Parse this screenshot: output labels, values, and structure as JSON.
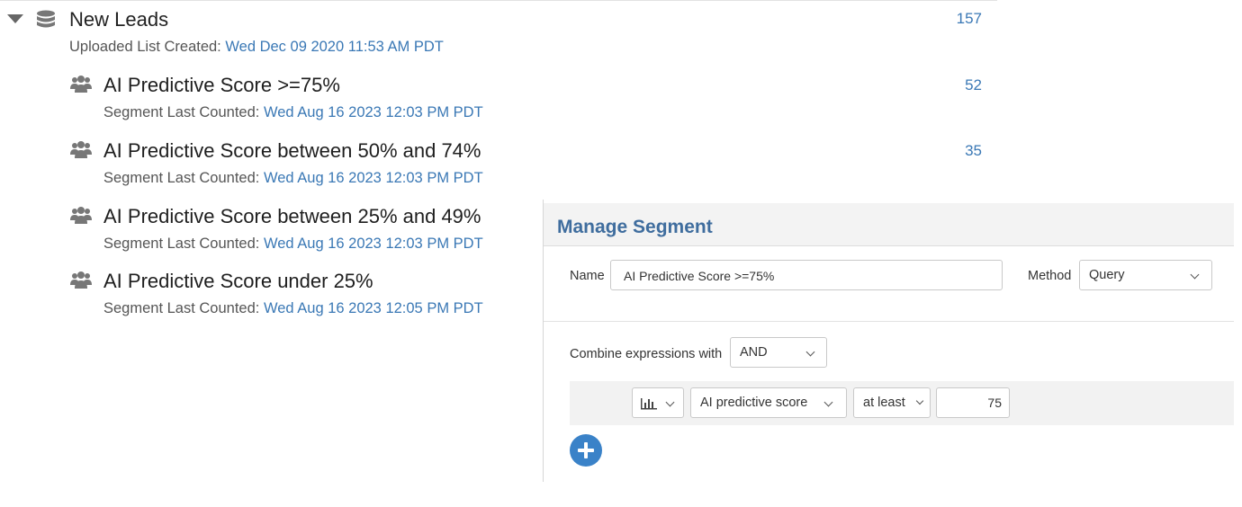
{
  "list": {
    "title": "New Leads",
    "created_label": "Uploaded List Created:",
    "created_value": "Wed Dec 09 2020 11:53 AM PDT",
    "count": "157",
    "icons": {
      "toggle": "caret-down-icon",
      "list": "database-icon"
    }
  },
  "segments": [
    {
      "title": "AI Predictive Score >=75%",
      "counted_label": "Segment Last Counted:",
      "counted_value": "Wed Aug 16 2023 12:03 PM PDT",
      "count": "52"
    },
    {
      "title": "AI Predictive Score between 50% and 74%",
      "counted_label": "Segment Last Counted:",
      "counted_value": "Wed Aug 16 2023 12:03 PM PDT",
      "count": "35"
    },
    {
      "title": "AI Predictive Score between 25% and 49%",
      "counted_label": "Segment Last Counted:",
      "counted_value": "Wed Aug 16 2023 12:03 PM PDT",
      "count": ""
    },
    {
      "title": "AI Predictive Score under 25%",
      "counted_label": "Segment Last Counted:",
      "counted_value": "Wed Aug 16 2023 12:05 PM PDT",
      "count": ""
    }
  ],
  "manage": {
    "title": "Manage Segment",
    "name_label": "Name",
    "name_value": "AI Predictive Score >=75%",
    "method_label": "Method",
    "method_value": "Query",
    "combine_label": "Combine expressions with",
    "combine_value": "AND",
    "expression": {
      "field_type_icon": "bar-chart-icon",
      "field": "AI predictive score",
      "operator": "at least",
      "value": "75"
    },
    "add_button_icon": "plus-circle-icon"
  },
  "colors": {
    "link": "#3a78b5",
    "panel_title": "#3f6d9e",
    "add_button": "#3a82c8"
  }
}
